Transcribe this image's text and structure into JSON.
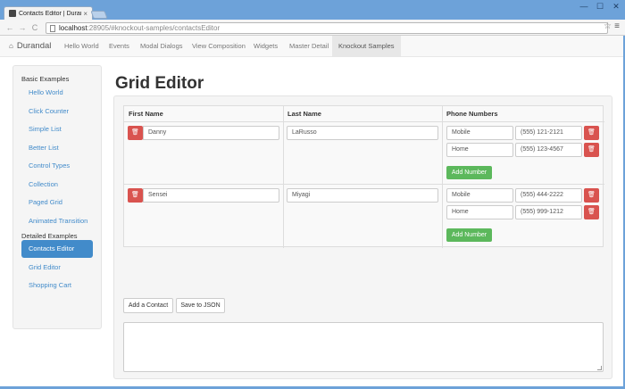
{
  "browser": {
    "tab_title": "Contacts Editor | Durand",
    "tab_close": "×",
    "url_host": "localhost",
    "url_path": ":28905/#knockout-samples/contactsEditor",
    "back": "←",
    "forward": "→",
    "reload": "C",
    "star": "☆",
    "menu": "≡",
    "win_min": "—",
    "win_max": "☐",
    "win_close": "✕"
  },
  "app": {
    "brand": "Durandal",
    "nav": [
      {
        "label": "Hello World"
      },
      {
        "label": "Events"
      },
      {
        "label": "Modal Dialogs"
      },
      {
        "label": "View Composition"
      },
      {
        "label": "Widgets"
      },
      {
        "label": "Master Detail"
      },
      {
        "label": "Knockout Samples"
      }
    ]
  },
  "sidebar": {
    "basic_header": "Basic Examples",
    "basic_items": [
      {
        "label": "Hello World"
      },
      {
        "label": "Click Counter"
      },
      {
        "label": "Simple List"
      },
      {
        "label": "Better List"
      },
      {
        "label": "Control Types"
      },
      {
        "label": "Collection"
      },
      {
        "label": "Paged Grid"
      },
      {
        "label": "Animated Transition"
      }
    ],
    "detailed_header": "Detailed Examples",
    "detailed_items": [
      {
        "label": "Contacts Editor",
        "active": true
      },
      {
        "label": "Grid Editor"
      },
      {
        "label": "Shopping Cart"
      }
    ]
  },
  "main": {
    "title": "Grid Editor",
    "columns": [
      "First Name",
      "Last Name",
      "Phone Numbers"
    ],
    "contacts": [
      {
        "first": "Danny",
        "last": "LaRusso",
        "phones": [
          {
            "type": "Mobile",
            "number": "(555) 121-2121"
          },
          {
            "type": "Home",
            "number": "(555) 123-4567"
          }
        ],
        "add_number": "Add Number"
      },
      {
        "first": "Sensei",
        "last": "Miyagi",
        "phones": [
          {
            "type": "Mobile",
            "number": "(555) 444-2222"
          },
          {
            "type": "Home",
            "number": "(555) 999-1212"
          }
        ],
        "add_number": "Add Number"
      }
    ],
    "add_contact": "Add a Contact",
    "save_json": "Save to JSON",
    "json_output": ""
  },
  "colors": {
    "primary": "#428bca",
    "danger": "#d9534f",
    "success": "#5cb85c"
  }
}
